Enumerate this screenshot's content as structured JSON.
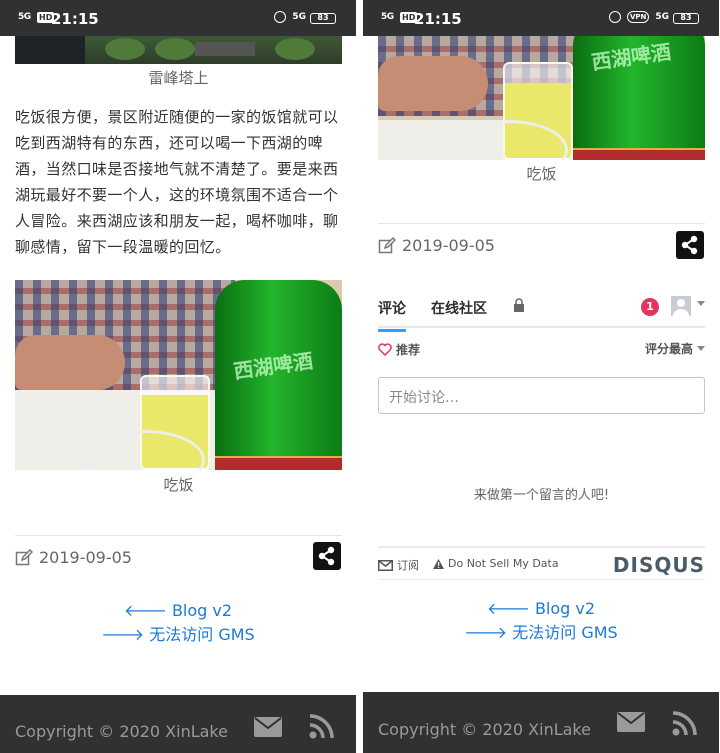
{
  "status_bar": {
    "signal": "5G",
    "hd": "HD",
    "time": "21:15",
    "network": "5G",
    "vpn": "VPN",
    "battery": "83"
  },
  "left_screen": {
    "tower_caption": "雷峰塔上",
    "paragraph": "吃饭很方便，景区附近随便的一家的饭馆就可以吃到西湖特有的东西，还可以喝一下西湖的啤酒，当然口味是否接地气就不清楚了。要是来西湖玩最好不要一个人，这的环境氛围不适合一个人冒险。来西湖应该和朋友一起，喝杯咖啡，聊聊感情，留下一段温暖的回忆。",
    "food_caption": "吃饭",
    "bottle_text": "西湖啤酒",
    "date": "2019-09-05",
    "nav": {
      "prev": "Blog v2",
      "next": "无法访问 GMS"
    },
    "footer_copyright": "Copyright © 2020 XinLake"
  },
  "right_screen": {
    "food_caption": "吃饭",
    "bottle_text": "西湖啤酒",
    "date": "2019-09-05",
    "disqus": {
      "tab_comments": "评论",
      "tab_community": "在线社区",
      "notification_count": "1",
      "recommend": "推荐",
      "sort": "评分最高",
      "input_placeholder": "开始讨论…",
      "empty_text": "来做第一个留言的人吧!",
      "subscribe": "订阅",
      "do_not_sell": "Do Not Sell My Data",
      "logo": "DISQUS"
    },
    "nav": {
      "prev": "Blog v2",
      "next": "无法访问 GMS"
    },
    "footer_copyright": "Copyright © 2020 XinLake"
  },
  "colors": {
    "status_bar_bg": "#2f3133",
    "link_blue": "#1b7ad8",
    "disqus_accent": "#2e9fff",
    "badge_red": "#e0375e"
  }
}
